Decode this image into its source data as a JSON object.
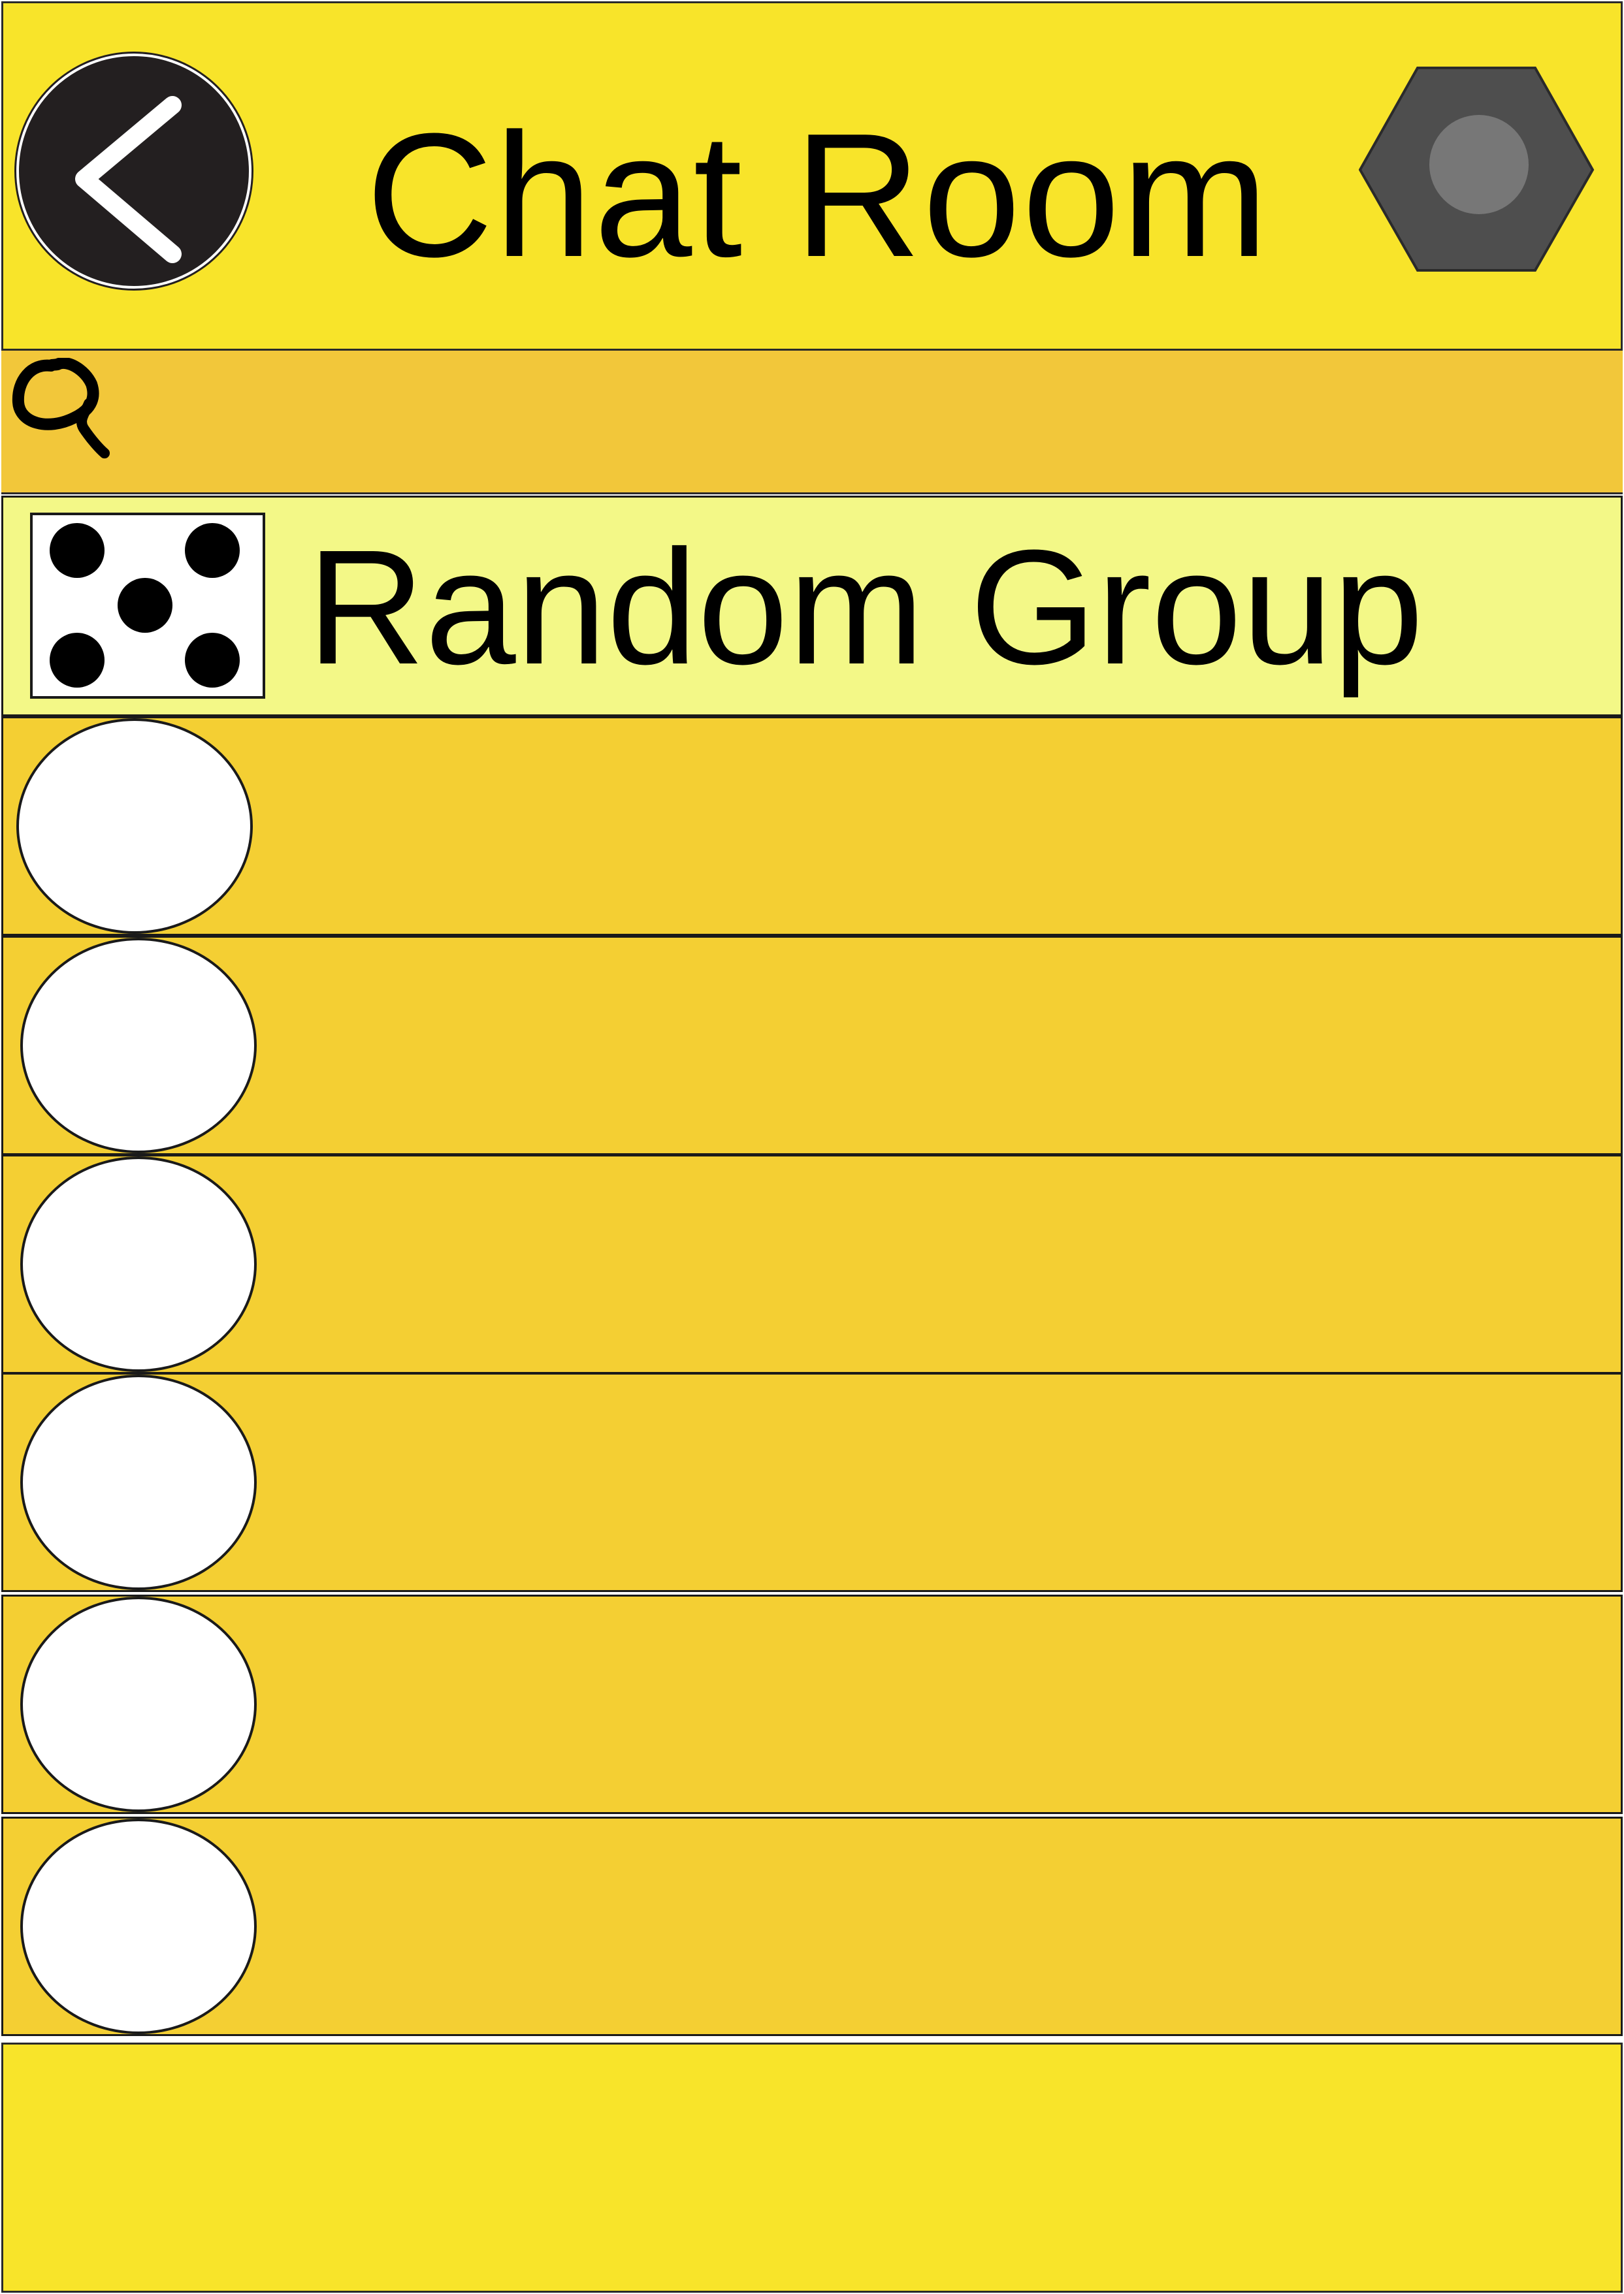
{
  "header": {
    "title": "Chat Room",
    "back_icon": "chevron-left-icon",
    "settings_icon": "hexagon-settings-icon",
    "background_color": "#F8E42A"
  },
  "search": {
    "icon": "search-icon",
    "background_color": "#F2C73A"
  },
  "group": {
    "label": "Random Group",
    "icon": "dice-five-icon",
    "background_color": "#F3F887"
  },
  "chat_rows": [
    {
      "avatar": "empty-avatar"
    },
    {
      "avatar": "empty-avatar"
    },
    {
      "avatar": "empty-avatar"
    },
    {
      "avatar": "empty-avatar"
    },
    {
      "avatar": "empty-avatar"
    },
    {
      "avatar": "empty-avatar"
    }
  ],
  "row_color": "#F4CF33",
  "footer": {
    "background_color": "#F8E42A"
  }
}
